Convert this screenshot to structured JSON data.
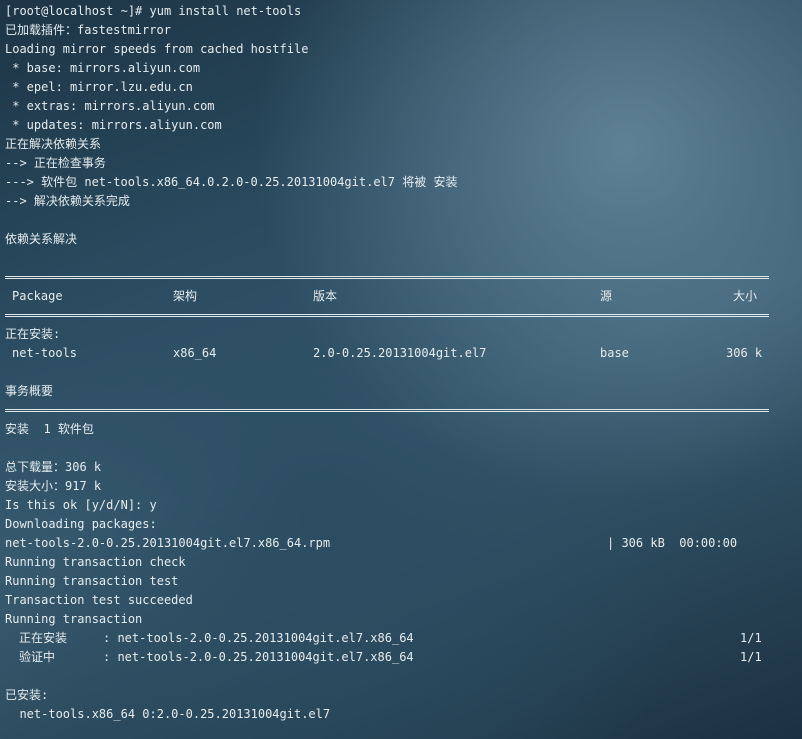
{
  "lines": [
    "[root@localhost ~]# yum install net-tools",
    "已加载插件：fastestmirror",
    "Loading mirror speeds from cached hostfile",
    " * base: mirrors.aliyun.com",
    " * epel: mirror.lzu.edu.cn",
    " * extras: mirrors.aliyun.com",
    " * updates: mirrors.aliyun.com",
    "正在解决依赖关系",
    "--> 正在检查事务",
    "---> 软件包 net-tools.x86_64.0.2.0-0.25.20131004git.el7 将被 安装",
    "--> 解决依赖关系完成",
    "依赖关系解决",
    "正在安装:",
    "事务概要",
    "安装  1 软件包",
    "总下载量：306 k",
    "安装大小：917 k",
    "Is this ok [y/d/N]: y",
    "Downloading packages:",
    "Running transaction check",
    "Running transaction test",
    "Transaction test succeeded",
    "Running transaction",
    "已安装:",
    "  net-tools.x86_64 0:2.0-0.25.20131004git.el7"
  ],
  "table": {
    "headers": {
      "package": "Package",
      "arch": "架构",
      "version": "版本",
      "repo": "源",
      "size": "大小"
    },
    "row": {
      "package": "net-tools",
      "arch": "x86_64",
      "version": "2.0-0.25.20131004git.el7",
      "repo": "base",
      "size": "306 k"
    }
  },
  "download": {
    "file": "net-tools-2.0-0.25.20131004git.el7.x86_64.rpm",
    "stats": "| 306 kB  00:00:00"
  },
  "steps": [
    {
      "label": "正在安装",
      "pkg": ": net-tools-2.0-0.25.20131004git.el7.x86_64",
      "count": "1/1"
    },
    {
      "label": "验证中",
      "pkg": ": net-tools-2.0-0.25.20131004git.el7.x86_64",
      "count": "1/1"
    }
  ]
}
